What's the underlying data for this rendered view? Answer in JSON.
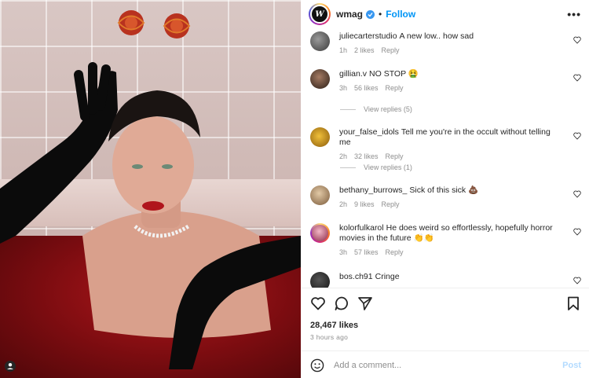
{
  "header": {
    "username": "wmag",
    "avatar_text": "W",
    "dot": "•",
    "follow_label": "Follow",
    "more_label": "•••"
  },
  "comments": [
    {
      "username": "juliecarterstudio",
      "text": "A new low.. how sad",
      "time": "1h",
      "likes": "2 likes",
      "reply": "Reply",
      "avatar_color": "#4a4a4a"
    },
    {
      "username": "gillian.v",
      "text": "NO STOP 🤮",
      "time": "3h",
      "likes": "56 likes",
      "reply": "Reply",
      "avatar_color": "#3a2a22",
      "view_replies": "View replies (5)"
    },
    {
      "username": "your_false_idols",
      "text": "Tell me you're in the occult without telling me",
      "time": "2h",
      "likes": "32 likes",
      "reply": "Reply",
      "avatar_color": "#c98a1a",
      "view_replies": "View replies (1)"
    },
    {
      "username": "bethany_burrows_",
      "text": "Sick of this sick 💩",
      "time": "2h",
      "likes": "9 likes",
      "reply": "Reply",
      "avatar_color": "#b79a72"
    },
    {
      "username": "kolorfulkarol",
      "text": "He does weird so effortlessly, hopefully horror movies in the future 👏👏",
      "time": "3h",
      "likes": "57 likes",
      "reply": "Reply",
      "avatar_color": "#c2185b"
    },
    {
      "username": "bos.ch91",
      "text": "Cringe",
      "avatar_color": "#2b2b2b"
    }
  ],
  "actions": {
    "likes": "28,467 likes",
    "time": "3 hours ago"
  },
  "add_comment": {
    "placeholder": "Add a comment...",
    "post_label": "Post"
  },
  "colors": {
    "accent": "#0095f6",
    "verified": "#3897f0",
    "muted": "#8e8e8e"
  }
}
